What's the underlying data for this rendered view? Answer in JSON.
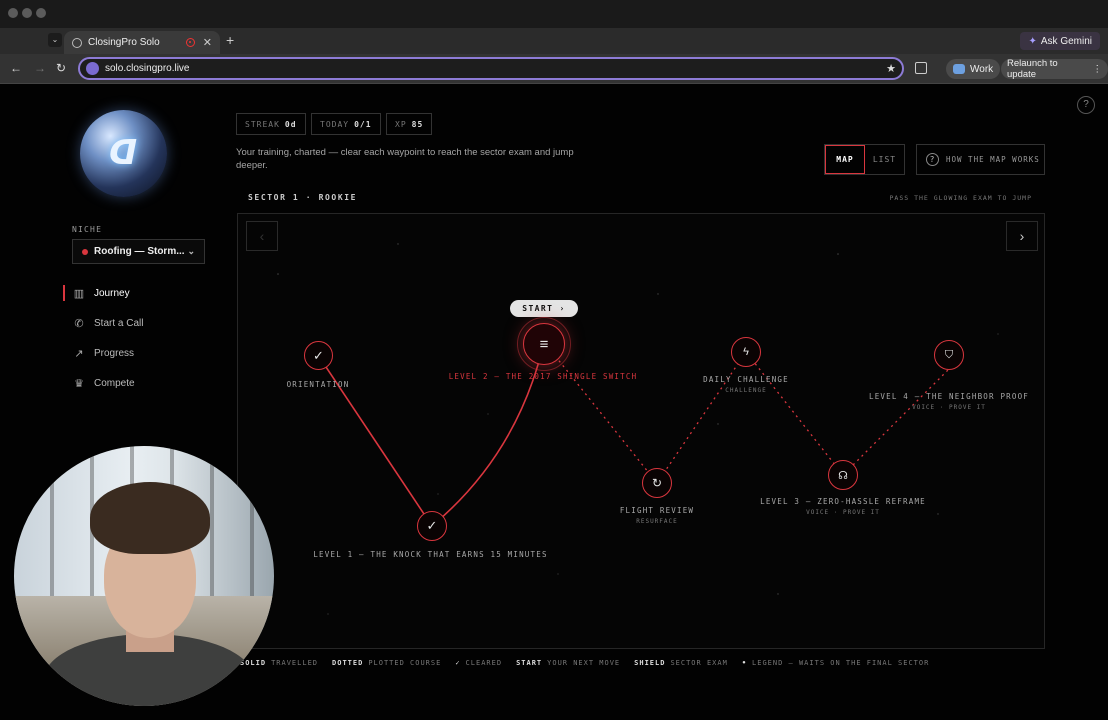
{
  "browser": {
    "tab_title": "ClosingPro Solo",
    "new_tab": "+",
    "ask_gemini": "Ask Gemini",
    "url": "solo.closingpro.live",
    "profile": "Work",
    "relaunch": "Relaunch to update"
  },
  "sidebar": {
    "niche_label": "NICHE",
    "niche_value": "Roofing — Storm...",
    "items": [
      {
        "label": "Journey",
        "icon": "map-icon",
        "active": true
      },
      {
        "label": "Start a Call",
        "icon": "phone-icon",
        "active": false
      },
      {
        "label": "Progress",
        "icon": "trend-icon",
        "active": false
      },
      {
        "label": "Compete",
        "icon": "trophy-icon",
        "active": false
      }
    ]
  },
  "stats": [
    {
      "label": "STREAK",
      "value": "0d"
    },
    {
      "label": "TODAY",
      "value": "0/1"
    },
    {
      "label": "XP",
      "value": "85"
    }
  ],
  "subtitle": "Your training, charted — clear each waypoint to reach the sector exam and jump deeper.",
  "view_toggle": {
    "map": "MAP",
    "list": "LIST",
    "selected": "MAP"
  },
  "how_button": "HOW THE MAP WORKS",
  "sector": {
    "title": "SECTOR 1 · ROOKIE",
    "hint": "PASS THE GLOWING EXAM TO JUMP"
  },
  "map": {
    "start_label": "START ›",
    "nodes": [
      {
        "label": "ORIENTATION",
        "sub": "",
        "state": "cleared"
      },
      {
        "label": "LEVEL 1 — THE KNOCK THAT EARNS 15 MINUTES",
        "sub": "",
        "state": "cleared"
      },
      {
        "label": "LEVEL 2 — THE 2017 SHINGLE SWITCH",
        "sub": "",
        "state": "current"
      },
      {
        "label": "FLIGHT REVIEW",
        "sub": "RESURFACE",
        "state": "plotted"
      },
      {
        "label": "DAILY CHALLENGE",
        "sub": "CHALLENGE",
        "state": "plotted"
      },
      {
        "label": "LEVEL 3 — ZERO-HASSLE REFRAME",
        "sub": "VOICE · PROVE IT",
        "state": "plotted"
      },
      {
        "label": "LEVEL 4 — THE NEIGHBOR PROOF",
        "sub": "VOICE · PROVE IT",
        "state": "exam"
      }
    ]
  },
  "legend": [
    {
      "key": "SOLID",
      "text": "TRAVELLED"
    },
    {
      "key": "DOTTED",
      "text": "PLOTTED COURSE"
    },
    {
      "key": "✓",
      "text": "CLEARED"
    },
    {
      "key": "START",
      "text": "YOUR NEXT MOVE"
    },
    {
      "key": "SHIELD",
      "text": "SECTOR EXAM"
    },
    {
      "key": "•",
      "text": "LEGEND — WAITS ON THE FINAL SECTOR"
    }
  ],
  "colors": {
    "accent": "#d9363e",
    "bg": "#020202"
  }
}
